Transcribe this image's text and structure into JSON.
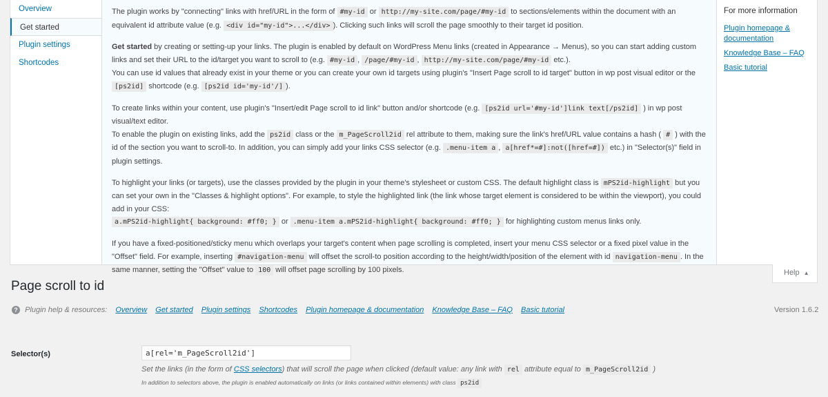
{
  "help_tabs": [
    {
      "label": "Overview"
    },
    {
      "label": "Get started"
    },
    {
      "label": "Plugin settings"
    },
    {
      "label": "Shortcodes"
    }
  ],
  "help_content": {
    "p1": {
      "t1": "The plugin works by \"connecting\" links with href/URL in the form of",
      "c1": "#my-id",
      "t2": "or",
      "c2": "http://my-site.com/page/#my-id",
      "t3": "to sections/elements within the document with an equivalent id attribute value (e.g.",
      "c3": "<div id=\"my-id\">...</div>",
      "t4": "). Clicking such links will scroll the page smoothly to their target id position."
    },
    "p2": {
      "strong": "Get started",
      "t1": "by creating or setting-up your links. The plugin is enabled by default on WordPress Menu links (created in Appearance → Menus), so you can start adding custom links and set their URL to the id/target you want to scroll to (e.g.",
      "c1": "#my-id",
      "c2": "/page/#my-id",
      "c3": "http://my-site.com/page/#my-id",
      "t2": "etc.).",
      "t3": "You can use id values that already exist in your theme or you can create your own id targets using plugin's \"Insert Page scroll to id target\" button in wp post visual editor or the",
      "c4": "[ps2id]",
      "t4": "shortcode (e.g.",
      "c5": "[ps2id id='my-id'/]",
      "t5": ")."
    },
    "p3": {
      "t1": "To create links within your content, use plugin's \"Insert/edit Page scroll to id link\" button and/or shortcode (e.g.",
      "c1": "[ps2id url='#my-id']link text[/ps2id]",
      "t2": ") in wp post visual/text editor.",
      "t3": "To enable the plugin on existing links, add the",
      "c2": "ps2id",
      "t4": "class or the",
      "c3": "m_PageScroll2id",
      "t5": "rel attribute to them, making sure the link's href/URL value contains a hash (",
      "c4": "#",
      "t6": ") with the id of the section you want to scroll-to. In addition, you can simply add your links CSS selector (e.g.",
      "c5": ".menu-item a",
      "c6": "a[href*=#]:not([href=#])",
      "t7": "etc.) in \"Selector(s)\" field in plugin settings."
    },
    "p4": {
      "t1": "To highlight your links (or targets), use the classes provided by the plugin in your theme's stylesheet or custom CSS. The default highlight class is",
      "c1": "mPS2id-highlight",
      "t2": "but you can set your own in the \"Classes & highlight options\". For example, to style the highlighted link (the link whose target element is considered to be within the viewport), you could add in your CSS:",
      "c2": "a.mPS2id-highlight{ background: #ff0; }",
      "t3": "or",
      "c3": ".menu-item a.mPS2id-highlight{ background: #ff0; }",
      "t4": "for highlighting custom menus links only."
    },
    "p5": {
      "t1": "If you have a fixed-positioned/sticky menu which overlaps your target's content when page scrolling is completed, insert your menu CSS selector or a fixed pixel value in the \"Offset\" field. For example, inserting",
      "c1": "#navigation-menu",
      "t2": "will offset the scroll-to position according to the height/width/position of the element with id",
      "c2": "navigation-menu",
      "t3": ". In the same manner, setting the \"Offset\" value to",
      "c3": "100",
      "t4": "will offset page scrolling by 100 pixels."
    }
  },
  "help_sidebar": {
    "heading": "For more information",
    "links": [
      "Plugin homepage & documentation",
      "Knowledge Base – FAQ",
      "Basic tutorial"
    ]
  },
  "help_toggle": {
    "label": "Help",
    "arrow": "▲"
  },
  "page_title": "Page scroll to id",
  "resources": {
    "label": "Plugin help & resources:",
    "links": [
      "Overview",
      "Get started",
      "Plugin settings",
      "Shortcodes",
      "Plugin homepage & documentation",
      "Knowledge Base – FAQ",
      "Basic tutorial"
    ],
    "version": "Version 1.6.2"
  },
  "selector_field": {
    "label": "Selector(s)",
    "value": "a[rel='m_PageScroll2id']",
    "desc_t1": "Set the links (in the form of",
    "desc_link": "CSS selectors",
    "desc_t2": ") that will scroll the page when clicked (default value: any link with",
    "desc_c1": "rel",
    "desc_t3": "attribute equal to",
    "desc_c2": "m_PageScroll2id",
    "desc_t4": ")",
    "note_t1": "In addition to selectors above, the plugin is enabled automatically on links (or links contained within elements) with class",
    "note_c1": "ps2id"
  }
}
